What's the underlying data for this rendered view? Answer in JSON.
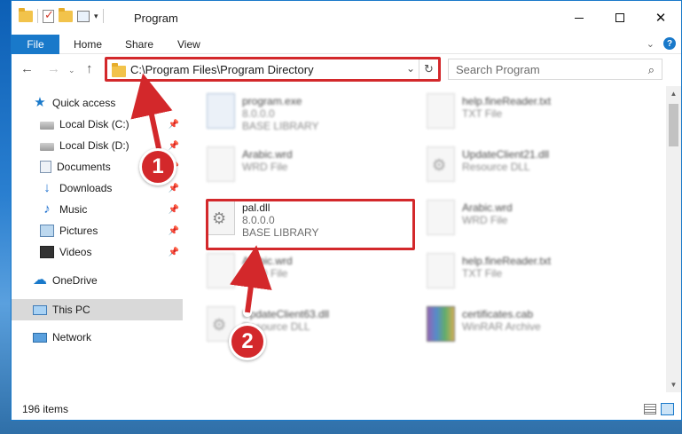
{
  "window": {
    "title": "Program",
    "controls": {
      "minimize": "minimize",
      "maximize": "maximize",
      "close": "✕"
    }
  },
  "ribbon": {
    "tabs": [
      "File",
      "Home",
      "Share",
      "View"
    ],
    "collapse": "⌄",
    "help": "?"
  },
  "address": {
    "path": "C:\\Program Files\\Program Directory",
    "dropdown": "⌄",
    "refresh": "↻"
  },
  "search": {
    "placeholder": "Search Program",
    "icon": "⌕"
  },
  "nav": {
    "back": "←",
    "forward": "→",
    "history": "⌄",
    "up": "↑"
  },
  "sidebar": {
    "items": [
      {
        "label": "Quick access",
        "icon": "star-icon",
        "pinned": false
      },
      {
        "label": "Local Disk (C:)",
        "icon": "disk-icon",
        "pinned": true
      },
      {
        "label": "Local Disk (D:)",
        "icon": "disk-icon",
        "pinned": true
      },
      {
        "label": "Documents",
        "icon": "documents-icon",
        "pinned": true
      },
      {
        "label": "Downloads",
        "icon": "download-icon",
        "pinned": true
      },
      {
        "label": "Music",
        "icon": "music-icon",
        "pinned": true
      },
      {
        "label": "Pictures",
        "icon": "pictures-icon",
        "pinned": true
      },
      {
        "label": "Videos",
        "icon": "videos-icon",
        "pinned": true
      },
      {
        "label": "OneDrive",
        "icon": "cloud-icon",
        "pinned": false
      },
      {
        "label": "This PC",
        "icon": "computer-icon",
        "pinned": false,
        "selected": true
      },
      {
        "label": "Network",
        "icon": "network-icon",
        "pinned": false
      }
    ]
  },
  "files": [
    {
      "name": "program.exe",
      "line2": "8.0.0.0",
      "line3": "BASE LIBRARY",
      "icon": "exe-icon",
      "blurred": true
    },
    {
      "name": "help.fineReader.txt",
      "line2": "TXT File",
      "line3": "",
      "icon": "text-file-icon",
      "blurred": true
    },
    {
      "name": "Arabic.wrd",
      "line2": "WRD File",
      "line3": "",
      "icon": "file-icon",
      "blurred": true
    },
    {
      "name": "UpdateClient21.dll",
      "line2": "Resource DLL",
      "line3": "",
      "icon": "dll-icon",
      "blurred": true
    },
    {
      "name": "pal.dll",
      "line2": "8.0.0.0",
      "line3": "BASE LIBRARY",
      "icon": "dll-icon",
      "blurred": false
    },
    {
      "name": "Arabic.wrd",
      "line2": "WRD File",
      "line3": "",
      "icon": "file-icon",
      "blurred": true
    },
    {
      "name": "Arabic.wrd",
      "line2": "WRD File",
      "line3": "",
      "icon": "file-icon",
      "blurred": true
    },
    {
      "name": "help.fineReader.txt",
      "line2": "TXT File",
      "line3": "",
      "icon": "text-file-icon",
      "blurred": true
    },
    {
      "name": "UpdateClient63.dll",
      "line2": "Resource DLL",
      "line3": "",
      "icon": "dll-icon",
      "blurred": true
    },
    {
      "name": "certificates.cab",
      "line2": "WinRAR Archive",
      "line3": "",
      "icon": "archive-icon",
      "blurred": true
    }
  ],
  "status": {
    "items": "196 items"
  },
  "annotations": {
    "step1": "1",
    "step2": "2",
    "color": "#d3282b"
  }
}
